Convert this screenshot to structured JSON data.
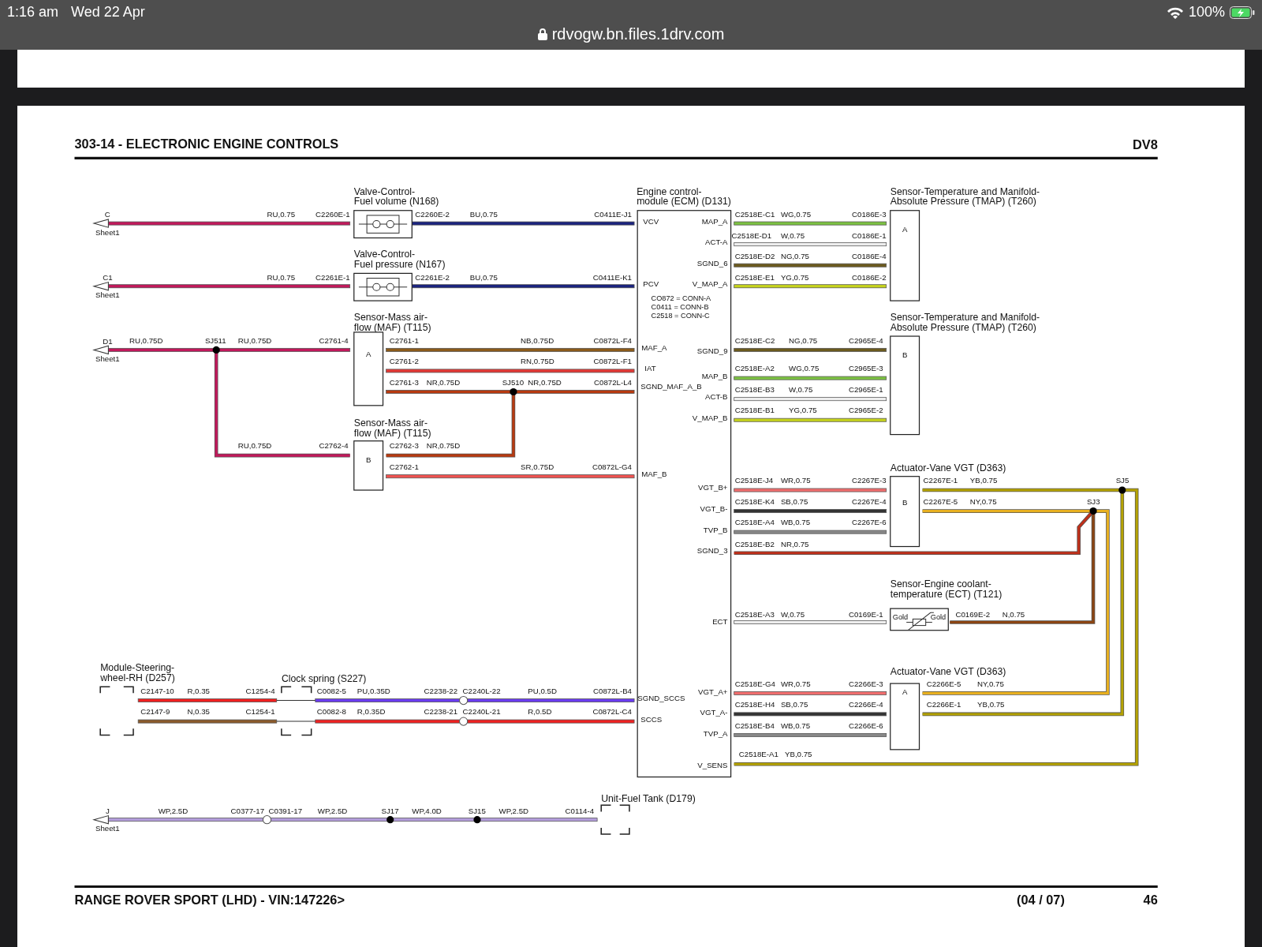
{
  "status_bar": {
    "time": "1:16 am",
    "date": "Wed 22 Apr",
    "battery": "100%"
  },
  "address_bar": {
    "url": "rdvogw.bn.files.1drv.com"
  },
  "page": {
    "title": "303-14 - ELECTRONIC ENGINE CONTROLS",
    "code": "DV8",
    "footer_vehicle": "RANGE ROVER SPORT  (LHD) - VIN:147226>",
    "footer_sheet": "(04 / 07)",
    "footer_page": "46"
  },
  "diagram": {
    "ecm": {
      "title": [
        "Engine control-",
        "module (ECM) (D131)"
      ],
      "pins_left": [
        "VCV",
        "PCV",
        "MAF_A",
        "IAT",
        "SGND_MAF_A_B",
        "MAF_B",
        "SGND_SCCS",
        "SCCS"
      ],
      "pins_right": [
        "MAP_A",
        "ACT-A",
        "SGND_6",
        "V_MAP_A",
        "SGND_9",
        "MAP_B",
        "ACT-B",
        "V_MAP_B",
        "VGT_B+",
        "VGT_B-",
        "TVP_B",
        "SGND_3",
        "ECT",
        "VGT_A+",
        "VGT_A-",
        "TVP_A",
        "V_SENS"
      ],
      "notes": [
        "CO872 = CONN-A",
        "C0411 = CONN-B",
        "C2518 = CONN-C"
      ]
    },
    "components": [
      {
        "kind": "valve",
        "title": [
          "Valve-Control-",
          "Fuel volume (N168)"
        ]
      },
      {
        "kind": "valve",
        "title": [
          "Valve-Control-",
          "Fuel pressure (N167)"
        ]
      },
      {
        "kind": "sensor",
        "title": [
          "Sensor-Mass air-",
          "flow (MAF) (T115)"
        ],
        "part": "A"
      },
      {
        "kind": "sensor",
        "title": [
          "Sensor-Mass air-",
          "flow (MAF) (T115)"
        ],
        "part": "B"
      },
      {
        "kind": "sensor",
        "title": [
          "Sensor-Temperature and Manifold-",
          "Absolute Pressure (TMAP) (T260)"
        ],
        "part": "A"
      },
      {
        "kind": "sensor",
        "title": [
          "Sensor-Temperature and Manifold-",
          "Absolute Pressure (TMAP) (T260)"
        ],
        "part": "B"
      },
      {
        "kind": "sensor",
        "title": [
          "Actuator-Vane VGT (D363)"
        ],
        "part": "B"
      },
      {
        "kind": "thermistor",
        "title": [
          "Sensor-Engine coolant-",
          "temperature (ECT) (T121)"
        ],
        "pins": [
          "Gold",
          "Gold"
        ]
      },
      {
        "kind": "sensor",
        "title": [
          "Actuator-Vane VGT (D363)"
        ],
        "part": "A"
      },
      {
        "kind": "bracket",
        "title": [
          "Module-Steering-",
          "wheel-RH (D257)"
        ]
      },
      {
        "kind": "bracket",
        "title": [
          "Clock spring (S227)"
        ]
      },
      {
        "kind": "bracket",
        "title": [
          "Unit-Fuel Tank (D179)"
        ]
      }
    ],
    "sheet_refs": [
      {
        "letter": "C",
        "sheet": "Sheet1"
      },
      {
        "letter": "C1",
        "sheet": "Sheet1"
      },
      {
        "letter": "D1",
        "sheet": "Sheet1"
      },
      {
        "letter": "J",
        "sheet": "Sheet1"
      }
    ],
    "splices": [
      "SJ511",
      "SJ510",
      "SJ5",
      "SJ3",
      "SJ17",
      "SJ15"
    ],
    "wires": [
      {
        "color": "#c2185b",
        "labels": [
          "RU,0.75",
          "C2260E-1"
        ]
      },
      {
        "color": "#1a237e",
        "labels": [
          "C2260E-2",
          "BU,0.75",
          "C0411E-J1"
        ]
      },
      {
        "color": "#c2185b",
        "labels": [
          "RU,0.75",
          "C2261E-1"
        ]
      },
      {
        "color": "#1a237e",
        "labels": [
          "C2261E-2",
          "BU,0.75",
          "C0411E-K1"
        ]
      },
      {
        "color": "#c2185b",
        "labels": [
          "RU,0.75D",
          "RU,0.75D",
          "C2761-4"
        ]
      },
      {
        "color": "#c2185b",
        "labels": [
          "RU,0.75D",
          "C2762-4"
        ]
      },
      {
        "color": "#8b5a1a",
        "labels": [
          "C2761-1",
          "NB,0.75D",
          "C0872L-F4"
        ]
      },
      {
        "color": "#e53935",
        "labels": [
          "C2761-2",
          "RN,0.75D",
          "C0872L-F1"
        ]
      },
      {
        "color": "#b83a10",
        "labels": [
          "C2761-3",
          "NR,0.75D",
          "NR,0.75D",
          "C0872L-L4"
        ]
      },
      {
        "color": "#b83a10",
        "labels": [
          "C2762-3",
          "NR,0.75D"
        ]
      },
      {
        "color": "#ef5350",
        "labels": [
          "C2762-1",
          "SR,0.75D",
          "C0872L-G4"
        ]
      },
      {
        "color": "#7cc242",
        "labels": [
          "C2518E-C1",
          "WG,0.75",
          "C0186E-3"
        ]
      },
      {
        "color": "#eeeeee",
        "labels": [
          "C2518E-D1",
          "W,0.75",
          "C0186E-1"
        ]
      },
      {
        "color": "#6b5a1e",
        "labels": [
          "C2518E-D2",
          "NG,0.75",
          "C0186E-4"
        ]
      },
      {
        "color": "#c6d31c",
        "labels": [
          "C2518E-E1",
          "YG,0.75",
          "C0186E-2"
        ]
      },
      {
        "color": "#6b5a1e",
        "labels": [
          "C2518E-C2",
          "NG,0.75",
          "C2965E-4"
        ]
      },
      {
        "color": "#7cc242",
        "labels": [
          "C2518E-A2",
          "WG,0.75",
          "C2965E-3"
        ]
      },
      {
        "color": "#eeeeee",
        "labels": [
          "C2518E-B3",
          "W,0.75",
          "C2965E-1"
        ]
      },
      {
        "color": "#c6d31c",
        "labels": [
          "C2518E-B1",
          "YG,0.75",
          "C2965E-2"
        ]
      },
      {
        "color": "#f06e6e",
        "labels": [
          "C2518E-J4",
          "WR,0.75",
          "C2267E-3"
        ]
      },
      {
        "color": "#333333",
        "labels": [
          "C2518E-K4",
          "SB,0.75",
          "C2267E-4"
        ]
      },
      {
        "color": "#888888",
        "labels": [
          "C2518E-A4",
          "WB,0.75",
          "C2267E-6"
        ]
      },
      {
        "color": "#c0301a",
        "labels": [
          "C2518E-B2",
          "NR,0.75"
        ]
      },
      {
        "color": "#b5a300",
        "labels": [
          "C2267E-1",
          "YB,0.75",
          "C2518E-A1",
          "YB,0.75"
        ]
      },
      {
        "color": "#e8b020",
        "labels": [
          "C2267E-5",
          "NY,0.75",
          "C2266E-5",
          "NY,0.75"
        ]
      },
      {
        "color": "#b5a300",
        "labels": [
          "C2266E-1",
          "YB,0.75"
        ]
      },
      {
        "color": "#eeeeee",
        "labels": [
          "C2518E-A3",
          "W,0.75",
          "C0169E-1"
        ]
      },
      {
        "color": "#8b4513",
        "labels": [
          "C0169E-2",
          "N,0.75"
        ]
      },
      {
        "color": "#f06e6e",
        "labels": [
          "C2518E-G4",
          "WR,0.75",
          "C2266E-3"
        ]
      },
      {
        "color": "#333333",
        "labels": [
          "C2518E-H4",
          "SB,0.75",
          "C2266E-4"
        ]
      },
      {
        "color": "#888888",
        "labels": [
          "C2518E-B4",
          "WB,0.75",
          "C2266E-6"
        ]
      },
      {
        "color": "#f02020",
        "labels": [
          "C2147-10",
          "R,0.35",
          "C1254-4"
        ]
      },
      {
        "color": "#8b5a2b",
        "labels": [
          "C2147-9",
          "N,0.35",
          "C1254-1"
        ]
      },
      {
        "color": "#6a3cf0",
        "labels": [
          "C0082-5",
          "PU,0.35D",
          "C2238-22",
          "C2240L-22",
          "PU,0.5D",
          "C0872L-B4"
        ]
      },
      {
        "color": "#f02020",
        "labels": [
          "C0082-8",
          "R,0.35D",
          "C2238-21",
          "C2240L-21",
          "R,0.5D",
          "C0872L-C4"
        ]
      },
      {
        "color": "#b39ddb",
        "labels": [
          "WP,2.5D",
          "C0377-17",
          "C0391-17",
          "WP,2.5D",
          "WP,4.0D",
          "WP,2.5D",
          "C0114-4"
        ]
      }
    ]
  }
}
